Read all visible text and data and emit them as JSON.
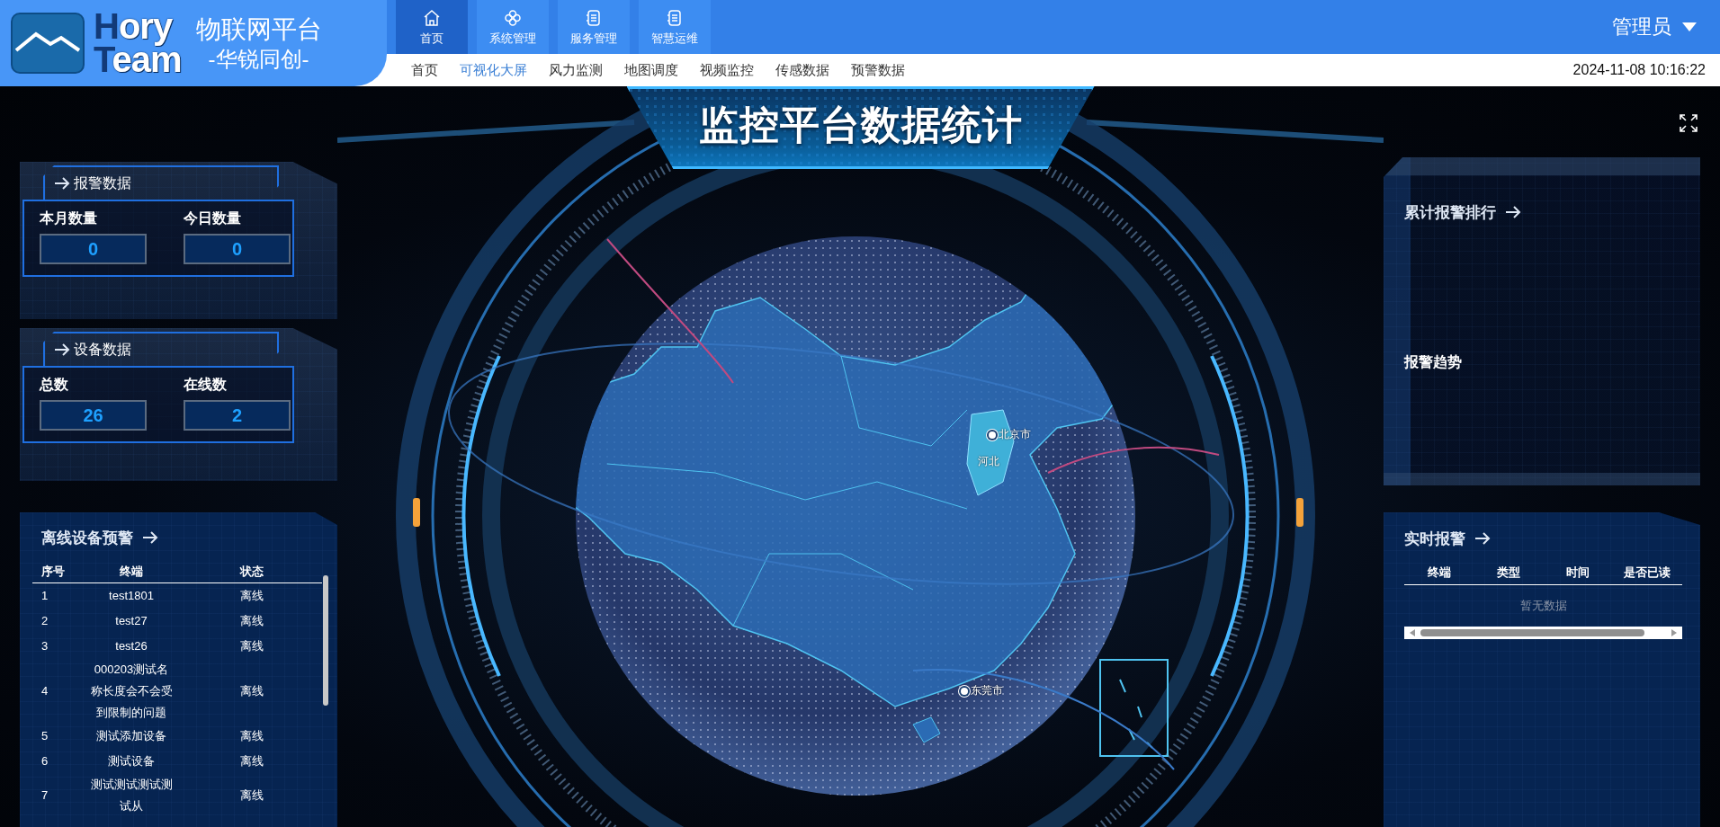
{
  "header": {
    "logo_lines": [
      "Hory",
      "Team"
    ],
    "platform_title": "物联网平台",
    "platform_subtitle": "-华锐同创-",
    "modules": [
      {
        "label": "首页",
        "kind": "home",
        "selected": true
      },
      {
        "label": "系统管理",
        "kind": "clover",
        "selected": false
      },
      {
        "label": "服务管理",
        "kind": "list",
        "selected": false
      },
      {
        "label": "智慧运维",
        "kind": "list",
        "selected": false
      }
    ],
    "user": "管理员",
    "nav": [
      {
        "label": "首页",
        "selected": false
      },
      {
        "label": "可视化大屏",
        "selected": true
      },
      {
        "label": "风力监测",
        "selected": false
      },
      {
        "label": "地图调度",
        "selected": false
      },
      {
        "label": "视频监控",
        "selected": false
      },
      {
        "label": "传感数据",
        "selected": false
      },
      {
        "label": "预警数据",
        "selected": false
      }
    ],
    "datetime": "2024-11-08 10:16:22"
  },
  "dashboard": {
    "title": "监控平台数据统计",
    "alarm_data": {
      "title": "报警数据",
      "stats": [
        {
          "label": "本月数量",
          "value": "0"
        },
        {
          "label": "今日数量",
          "value": "0"
        }
      ]
    },
    "device_data": {
      "title": "设备数据",
      "stats": [
        {
          "label": "总数",
          "value": "26"
        },
        {
          "label": "在线数",
          "value": "2"
        }
      ]
    },
    "offline_devices": {
      "title": "离线设备预警",
      "columns": [
        "序号",
        "终端",
        "状态"
      ],
      "rows": [
        [
          "1",
          "test1801",
          "离线"
        ],
        [
          "2",
          "test27",
          "离线"
        ],
        [
          "3",
          "test26",
          "离线"
        ],
        [
          "4",
          "000203测试名称长度会不会受到限制的问题",
          "离线"
        ],
        [
          "5",
          "测试添加设备",
          "离线"
        ],
        [
          "6",
          "测试设备",
          "离线"
        ],
        [
          "7",
          "测试测试测试测试从",
          "离线"
        ]
      ]
    },
    "map": {
      "labels": [
        {
          "text": "北京市",
          "kind": "city"
        },
        {
          "text": "河北",
          "kind": "province"
        },
        {
          "text": "东莞市",
          "kind": "city"
        }
      ]
    },
    "alarm_ranking": {
      "title": "累计报警排行"
    },
    "alarm_trend": {
      "title": "报警趋势"
    },
    "realtime_alarms": {
      "title": "实时报警",
      "columns": [
        "终端",
        "类型",
        "时间",
        "是否已读"
      ],
      "empty_text": "暂无数据"
    }
  }
}
